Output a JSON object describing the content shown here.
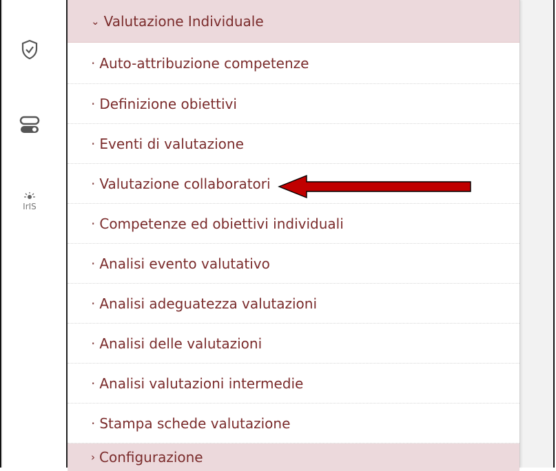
{
  "icons": [
    {
      "name": "shield-check-icon"
    },
    {
      "name": "toggle-icon"
    },
    {
      "name": "iris-logo-icon",
      "label": "IrIS"
    }
  ],
  "menu": {
    "header": {
      "label": "Valutazione Individuale",
      "chevron": "⌄"
    },
    "items": [
      {
        "label": "Auto-attribuzione competenze"
      },
      {
        "label": "Definizione obiettivi"
      },
      {
        "label": "Eventi di valutazione"
      },
      {
        "label": "Valutazione collaboratori"
      },
      {
        "label": "Competenze ed obiettivi individuali"
      },
      {
        "label": "Analisi evento valutativo"
      },
      {
        "label": "Analisi adeguatezza valutazioni"
      },
      {
        "label": "Analisi delle valutazioni"
      },
      {
        "label": "Analisi valutazioni intermedie"
      },
      {
        "label": "Stampa schede valutazione"
      }
    ],
    "bullet": "·",
    "footer": {
      "label": "Configurazione",
      "chevron": "›"
    }
  },
  "colors": {
    "accent": "#7a2b2b",
    "header_bg": "#ecd9dc",
    "arrow": "#c00000"
  }
}
